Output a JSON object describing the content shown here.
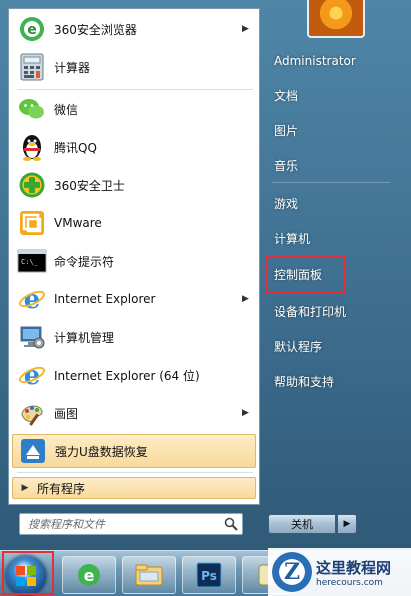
{
  "left_pane": {
    "items": [
      {
        "label": "360安全浏览器",
        "icon": "360-browser-icon",
        "has_arrow": true
      },
      {
        "label": "计算器",
        "icon": "calculator-icon",
        "has_arrow": false
      },
      {
        "label": "微信",
        "icon": "wechat-icon",
        "has_arrow": false
      },
      {
        "label": "腾讯QQ",
        "icon": "qq-penguin-icon",
        "has_arrow": false
      },
      {
        "label": "360安全卫士",
        "icon": "360-safeguard-icon",
        "has_arrow": false
      },
      {
        "label": "VMware",
        "icon": "vmware-icon",
        "has_arrow": false
      },
      {
        "label": "命令提示符",
        "icon": "command-prompt-icon",
        "has_arrow": false
      },
      {
        "label": "Internet Explorer",
        "icon": "internet-explorer-icon",
        "has_arrow": true
      },
      {
        "label": "计算机管理",
        "icon": "computer-management-icon",
        "has_arrow": false
      },
      {
        "label": "Internet Explorer (64 位)",
        "icon": "internet-explorer-icon",
        "has_arrow": false
      },
      {
        "label": "画图",
        "icon": "paint-icon",
        "has_arrow": true
      },
      {
        "label": "强力U盘数据恢复",
        "icon": "usb-recovery-icon",
        "has_arrow": false
      }
    ],
    "all_programs": "所有程序",
    "arrow_glyph": "▶"
  },
  "search": {
    "placeholder": "搜索程序和文件"
  },
  "right_pane": {
    "items": [
      "Administrator",
      "文档",
      "图片",
      "音乐",
      "游戏",
      "计算机",
      "控制面板",
      "设备和打印机",
      "默认程序",
      "帮助和支持"
    ],
    "shutdown_label": "关机",
    "shutdown_arrow": "▶"
  },
  "watermark": {
    "cn": "这里教程网",
    "en": "herecours.com",
    "logo_letter": "Z"
  },
  "colors": {
    "highlight_border": "#e1b868",
    "annotation_red": "#e1303a"
  }
}
